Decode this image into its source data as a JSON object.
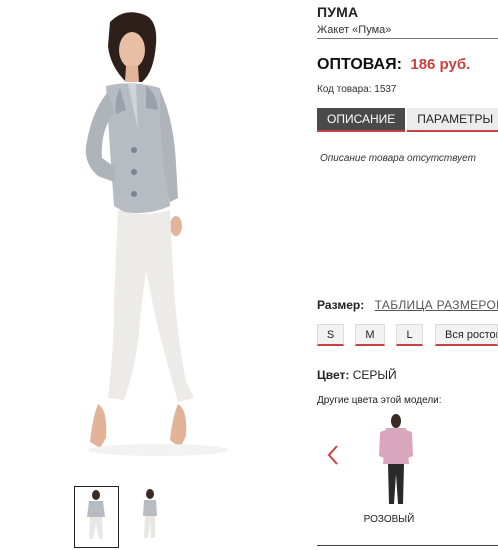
{
  "product": {
    "title": "ПУМА",
    "subtitle": "Жакет «Пума»",
    "price_label": "ОПТОВАЯ:",
    "price_value": "186 руб.",
    "sku": "Код товара: 1537"
  },
  "tabs": [
    {
      "label": "ОПИСАНИЕ",
      "active": true
    },
    {
      "label": "ПАРАМЕТРЫ",
      "active": false
    }
  ],
  "description": "Описание товара отсутствует",
  "size": {
    "label": "Размер:",
    "table_link": "ТАБЛИЦА РАЗМЕРОВ",
    "options": [
      "S",
      "M",
      "L",
      "Вся ростовка"
    ]
  },
  "color": {
    "label": "Цвет:",
    "value": "СЕРЫЙ",
    "other_label": "Другие цвета этой модели:",
    "variants": [
      {
        "name": "РОЗОВЫЙ"
      }
    ]
  },
  "icons": {
    "prev": "chevron-left-icon"
  },
  "colors": {
    "accent": "#c8423f",
    "tab_active": "#4a4a4a"
  }
}
